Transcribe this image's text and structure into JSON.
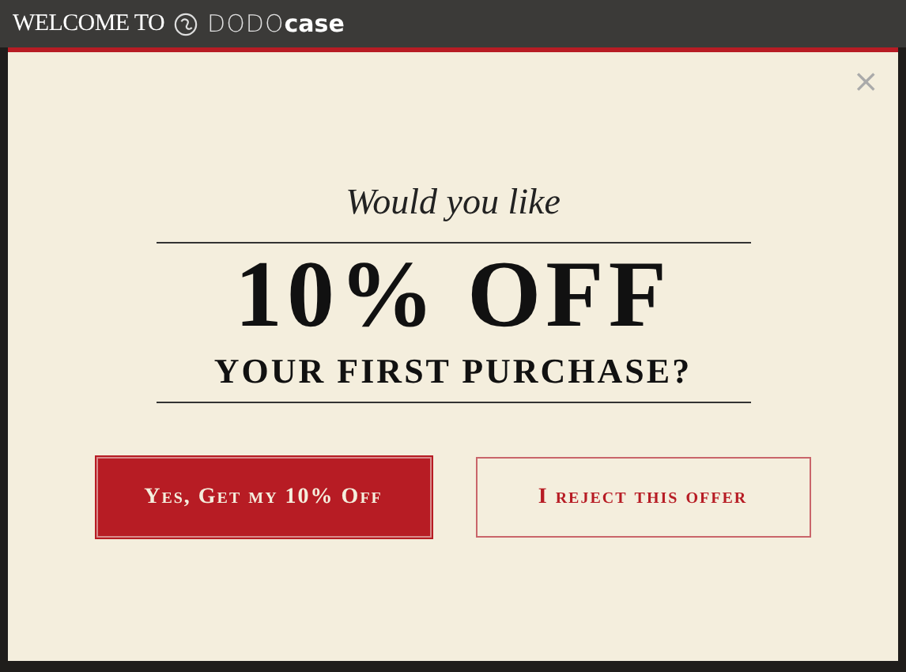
{
  "header": {
    "welcome": "WELCOME TO",
    "brand_light": "DODO",
    "brand_bold": "case"
  },
  "modal": {
    "intro": "Would you like",
    "headline": "10% OFF",
    "subheadline": "YOUR FIRST PURCHASE?",
    "buttons": [
      {
        "kind": "primary",
        "label": "Yes, Get my 10% Off"
      },
      {
        "kind": "secondary",
        "label": "I reject this offer"
      }
    ],
    "close": "×"
  }
}
